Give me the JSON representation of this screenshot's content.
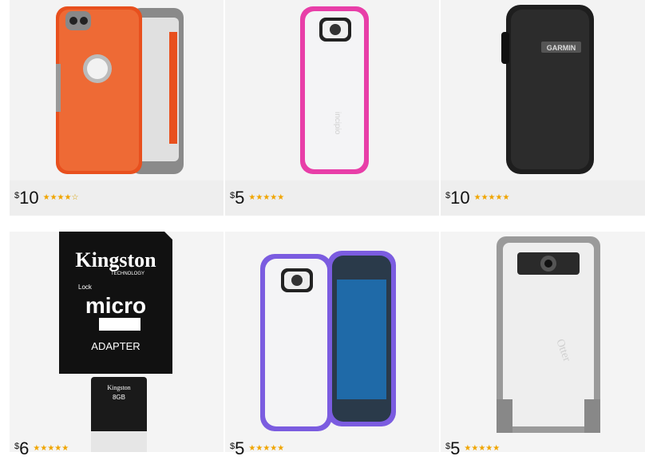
{
  "products": [
    {
      "id": "otterbox-iphone-orange",
      "currency": "$",
      "price": "10",
      "stars": [
        1,
        1,
        1,
        1,
        0
      ],
      "image": "orange-phone-case"
    },
    {
      "id": "incipio-pink-galaxy",
      "currency": "$",
      "price": "5",
      "stars": [
        1,
        1,
        1,
        1,
        0.5
      ],
      "image": "pink-clear-phone-case"
    },
    {
      "id": "garmin-pouch",
      "currency": "$",
      "price": "10",
      "stars": [
        1,
        1,
        1,
        1,
        0.5
      ],
      "image": "black-garmin-pouch",
      "logo_text": "GARMIN"
    },
    {
      "id": "kingston-microsd",
      "currency": "$",
      "price": "6",
      "stars": [
        1,
        1,
        1,
        1,
        0.5
      ],
      "image": "kingston-microsd-adapter",
      "logo_text": "Kingston",
      "tech_text": "TECHNOLOGY",
      "lock_text": "Lock",
      "micro_text": "micro",
      "adapter_text": "ADAPTER",
      "card_brand": "Kingston",
      "card_size": "8GB"
    },
    {
      "id": "incipio-purple-galaxy",
      "currency": "$",
      "price": "5",
      "stars": [
        1,
        1,
        1,
        1,
        0.5
      ],
      "image": "purple-clear-phone-case"
    },
    {
      "id": "otterbox-gray",
      "currency": "$",
      "price": "5",
      "stars": [
        1,
        1,
        1,
        1,
        0.5
      ],
      "image": "gray-otterbox-case",
      "logo_text": "Otter"
    }
  ],
  "colors": {
    "star": "#f0a500",
    "orange": "#e8501e",
    "pink": "#e83ea8",
    "purple": "#7b5ce0",
    "gray": "#9a9a9a"
  }
}
